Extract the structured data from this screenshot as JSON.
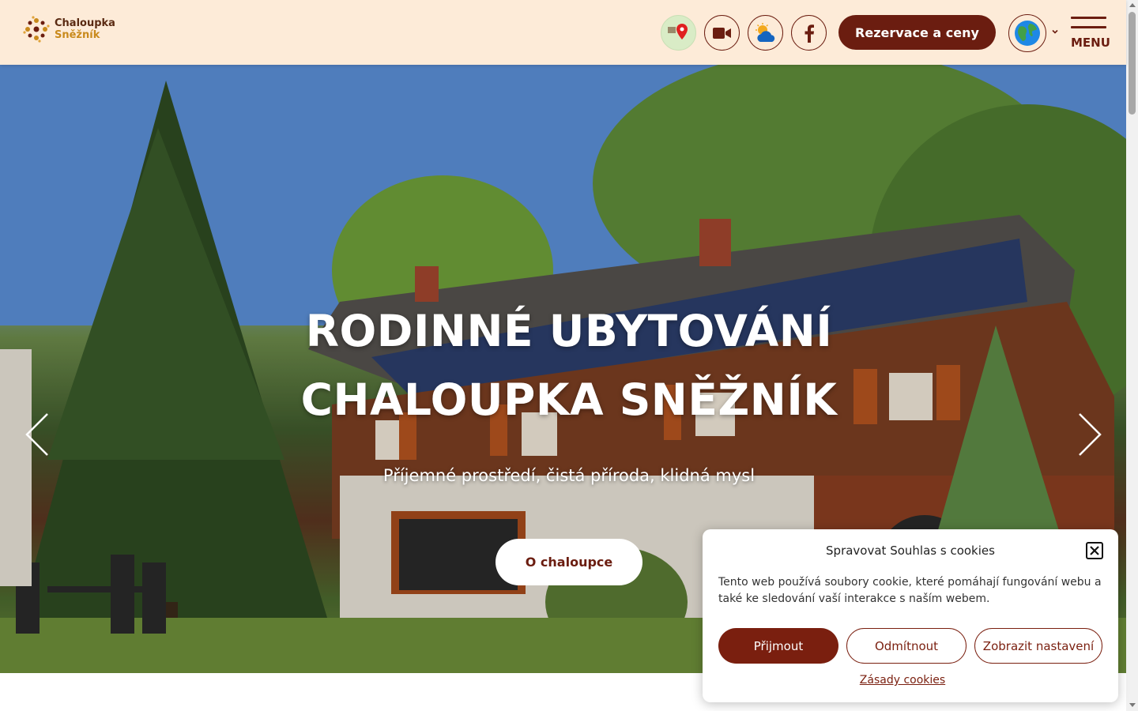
{
  "header": {
    "logo": {
      "line1": "Chaloupka",
      "line2": "Sněžník"
    },
    "icons": {
      "map": "map-pin-icon",
      "video": "video-camera-icon",
      "weather": "weather-icon",
      "facebook": "facebook-icon"
    },
    "reserve_label": "Rezervace a ceny",
    "language_icon": "globe-icon",
    "menu_label": "MENU"
  },
  "hero": {
    "title_line1": "RODINNÉ UBYTOVÁNÍ",
    "title_line2": "CHALOUPKA SNĚŽNÍK",
    "subtitle": "Příjemné prostředí, čistá příroda, klidná mysl",
    "cta_label": "O chaloupce",
    "slides_count": 4,
    "active_slide": 1
  },
  "cookie": {
    "title": "Spravovat Souhlas s cookies",
    "text": "Tento web používá soubory cookie, které pomáhají fungování webu a také ke sledování vaší interakce s naším webem.",
    "accept_label": "Přijmout",
    "deny_label": "Odmítnout",
    "settings_label": "Zobrazit nastavení",
    "policy_label": "Zásady cookies"
  },
  "colors": {
    "brand": "#6b1d10",
    "header_bg": "#fdebd8",
    "accent_gold": "#c98a1c"
  }
}
